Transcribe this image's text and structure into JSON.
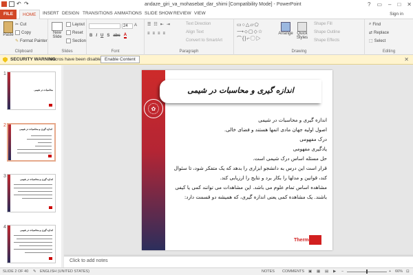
{
  "app": {
    "title": "andaze_giri_va_mohasebat_dar_shimi [Compatibility Mode] - PowerPoint",
    "signin": "Sign in"
  },
  "tabs": [
    "FILE",
    "HOME",
    "INSERT",
    "DESIGN",
    "TRANSITIONS",
    "ANIMATIONS",
    "SLIDE SHOW",
    "REVIEW",
    "VIEW"
  ],
  "active_tab": "HOME",
  "ribbon": {
    "clipboard": {
      "paste": "Paste",
      "cut": "Cut",
      "copy": "Copy",
      "format_painter": "Format Painter",
      "label": "Clipboard"
    },
    "slides": {
      "new_slide": "New Slide",
      "layout": "Layout",
      "reset": "Reset",
      "section": "Section",
      "label": "Slides"
    },
    "font": {
      "size": "24",
      "label": "Font"
    },
    "paragraph": {
      "text_direction": "Text Direction",
      "align_text": "Align Text",
      "convert_smartart": "Convert to SmartArt",
      "label": "Paragraph"
    },
    "drawing": {
      "arrange": "Arrange",
      "quick_styles": "Quick Styles",
      "shape_fill": "Shape Fill",
      "shape_outline": "Shape Outline",
      "shape_effects": "Shape Effects",
      "label": "Drawing"
    },
    "editing": {
      "find": "Find",
      "replace": "Replace",
      "select": "Select",
      "label": "Editing"
    }
  },
  "security_bar": {
    "label": "SECURITY WARNING",
    "message": "Macros have been disabled.",
    "button": "Enable Content"
  },
  "thumbnails": [
    {
      "number": "1",
      "title": "محاسبات در شیمی"
    },
    {
      "number": "2",
      "title": "اندازه گیری و محاسبات در شیمی"
    },
    {
      "number": "3",
      "title": "اندازه گیری و محاسبات در شیمی"
    },
    {
      "number": "4",
      "title": "اندازه گیری و محاسبات در شیمی"
    }
  ],
  "slide": {
    "title": "اندازه گیری و محاسبات در شیمی",
    "lines": [
      "اندازه گیری و محاسبات در شیمی",
      "اصول اولیه جهان مادی اتمها هستند و فضای خالی.",
      "درک مفهومی",
      "یادگیری مفهومی",
      "حل مسئله اساس درک شیمی است.",
      "قرار است این درس به دانشجو ابزاری را بدهد که یک متفکر شود، تا سئوال کند، قوانین و مدلها را بکار برد و نتایج را ارزیابی کند.",
      "مشاهده اساس تمام علوم می باشد. این مشاهدات می توانند کمی یا کیفی باشند. یک مشاهده کمی یعنی اندازه گیری، که همیشه دو قسمت دارد:"
    ],
    "logo_text": "Thermo"
  },
  "notes_placeholder": "Click to add notes",
  "status": {
    "slide_counter": "SLIDE 2 OF 40",
    "language": "ENGLISH (UNITED STATES)",
    "notes": "NOTES",
    "comments": "COMMENTS",
    "zoom": "66%"
  },
  "colors": {
    "accent": "#d24726",
    "slide_band_top": "#cd2a2a",
    "slide_band_bottom": "#2c2e5c",
    "warning_bg": "#fff4ce"
  }
}
